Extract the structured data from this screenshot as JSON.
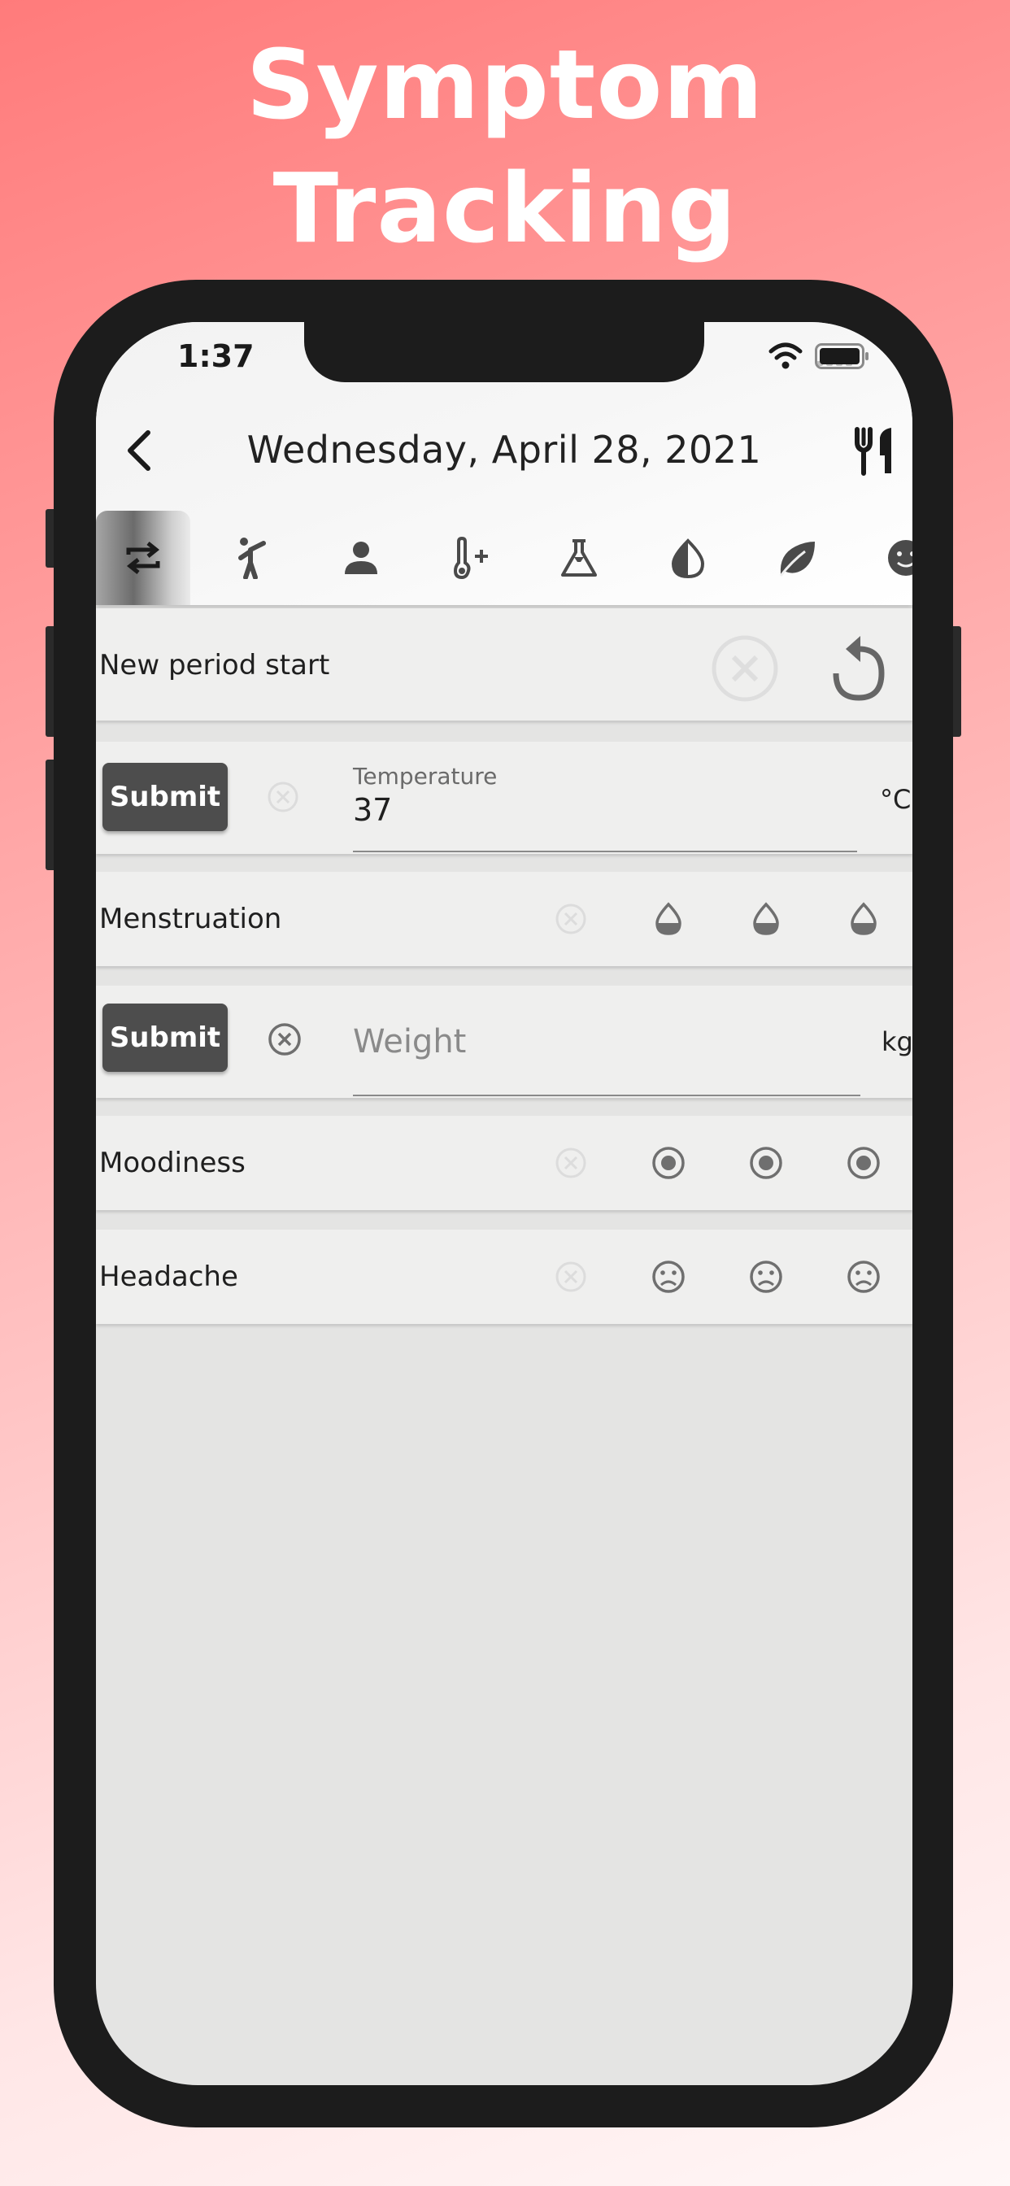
{
  "promo": {
    "title_line1": "Symptom",
    "title_line2": "Tracking"
  },
  "status_bar": {
    "time": "1:37"
  },
  "header": {
    "date_title": "Wednesday, April 28, 2021"
  },
  "tabs": [
    {
      "icon": "cycle-arrows-icon",
      "active": true
    },
    {
      "icon": "activity-person-icon"
    },
    {
      "icon": "person-icon"
    },
    {
      "icon": "thermometer-plus-icon"
    },
    {
      "icon": "flask-icon"
    },
    {
      "icon": "contrast-drop-icon"
    },
    {
      "icon": "leaf-icon"
    },
    {
      "icon": "smiley-icon"
    }
  ],
  "rows": {
    "period": {
      "label": "New period start"
    },
    "temperature": {
      "submit": "Submit",
      "field_label": "Temperature",
      "value": "37",
      "unit": "°C"
    },
    "menstruation": {
      "label": "Menstruation"
    },
    "weight": {
      "submit": "Submit",
      "placeholder": "Weight",
      "unit": "kg"
    },
    "moodiness": {
      "label": "Moodiness"
    },
    "headache": {
      "label": "Headache"
    }
  },
  "colors": {
    "accent_bg": "#ff7b7b",
    "dark_button": "#4d4d4d",
    "icon_gray": "#6f6f6f"
  }
}
